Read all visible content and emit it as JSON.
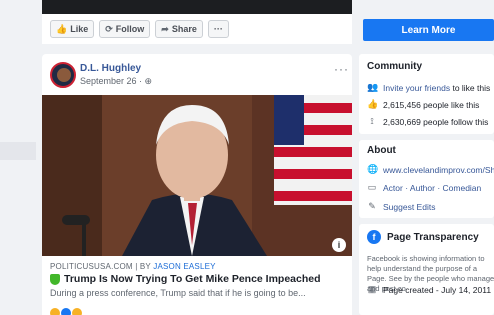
{
  "top_actions": [
    {
      "icon": "like-icon",
      "glyph": "👍",
      "label": "Like"
    },
    {
      "icon": "follow-icon",
      "glyph": "⟳",
      "label": "Follow"
    },
    {
      "icon": "share-icon",
      "glyph": "➦",
      "label": "Share"
    }
  ],
  "more_actions": "···",
  "learn_more": "Learn More",
  "post": {
    "author": "D.L. Hughley",
    "date": "September 26 · ",
    "globe": "⊕",
    "more": "···",
    "source": "POLITICUSUSA.COM | BY ",
    "source_by": "JASON EASLEY",
    "headline": "Trump Is Now Trying To Get Mike Pence Impeached",
    "description": "During a press conference, Trump said that if he is going to be...",
    "info": "i",
    "reaction_colors": [
      "#f7b125",
      "#1877f2",
      "#f7b125"
    ]
  },
  "community": {
    "title": "Community",
    "invite_link": "Invite your friends",
    "invite_rest": " to like this",
    "likes": "2,615,456 people like this",
    "follows": "2,630,669 people follow this"
  },
  "about": {
    "title": "About",
    "website": "www.clevelandimprov.com/Show",
    "category": "Actor · Author · Comedian",
    "suggest": "Suggest Edits"
  },
  "transparency": {
    "title": "Page Transparency",
    "desc": "Facebook is showing information to help understand the purpose of a Page. See by the people who manage and post co",
    "created": "Page created - July 14, 2011"
  }
}
